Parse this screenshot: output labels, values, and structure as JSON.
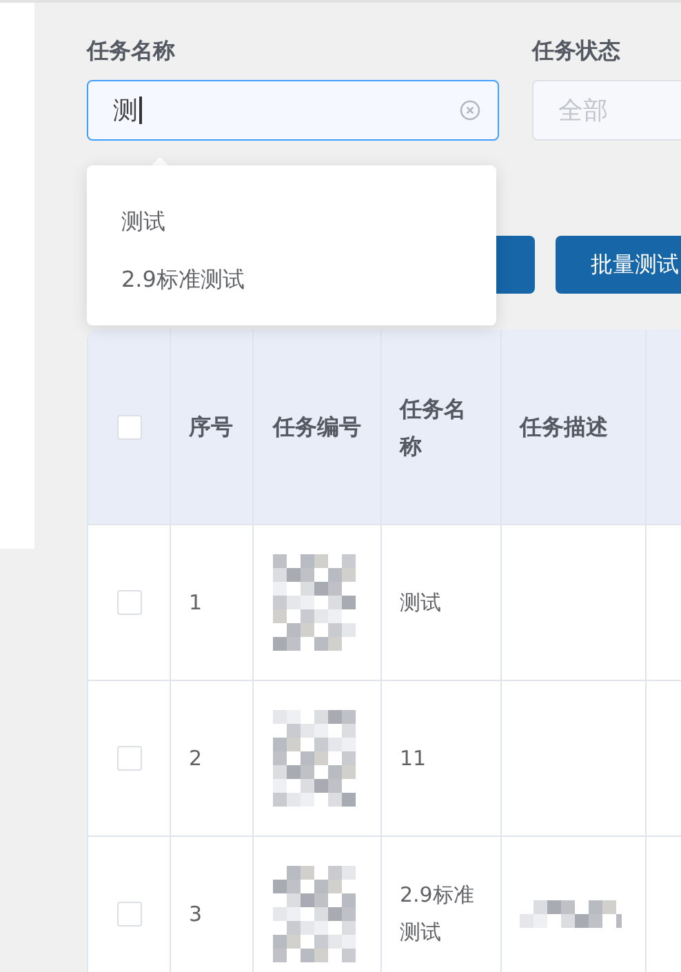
{
  "filters": [
    {
      "label": "任务名称",
      "kind": "input",
      "value": "测",
      "focused": true
    },
    {
      "label": "任务状态",
      "kind": "select",
      "placeholder": "全部",
      "focused": false
    }
  ],
  "suggestions": [
    "测试",
    "2.9标准测试"
  ],
  "buttons": [
    {
      "kind": "covered"
    },
    {
      "kind": "labeled",
      "label": "批量测试"
    }
  ],
  "table": {
    "columns": [
      "序号",
      "任务编号",
      "任务名称",
      "任务描述"
    ],
    "all_checked": false,
    "rows": [
      {
        "checked": false,
        "index": "1",
        "id_redacted": true,
        "name": "测试",
        "desc_redacted": false
      },
      {
        "checked": false,
        "index": "2",
        "id_redacted": true,
        "name": "11",
        "desc_redacted": false
      },
      {
        "checked": false,
        "index": "3",
        "id_redacted": true,
        "name": "2.9标准测试",
        "desc_redacted": true
      }
    ]
  }
}
